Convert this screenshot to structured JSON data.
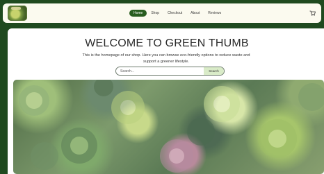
{
  "nav": {
    "links": [
      "Home",
      "Shop",
      "Checkout",
      "About",
      "Reviews"
    ],
    "active_index": 0
  },
  "icons": {
    "logo": "green-thumb-logo",
    "cart": "cart-icon"
  },
  "main": {
    "title": "WELCOME TO GREEN THUMB",
    "description": "This is the homepage of our shop. Here you can browse eco-friendly options to reduce waste and support a greener lifestyle.",
    "search": {
      "placeholder": "Search...",
      "button_label": "Search"
    }
  },
  "colors": {
    "page_bg": "#1f4a1f",
    "active_nav": "#285d1f",
    "search_button": "#d9ebc8"
  }
}
